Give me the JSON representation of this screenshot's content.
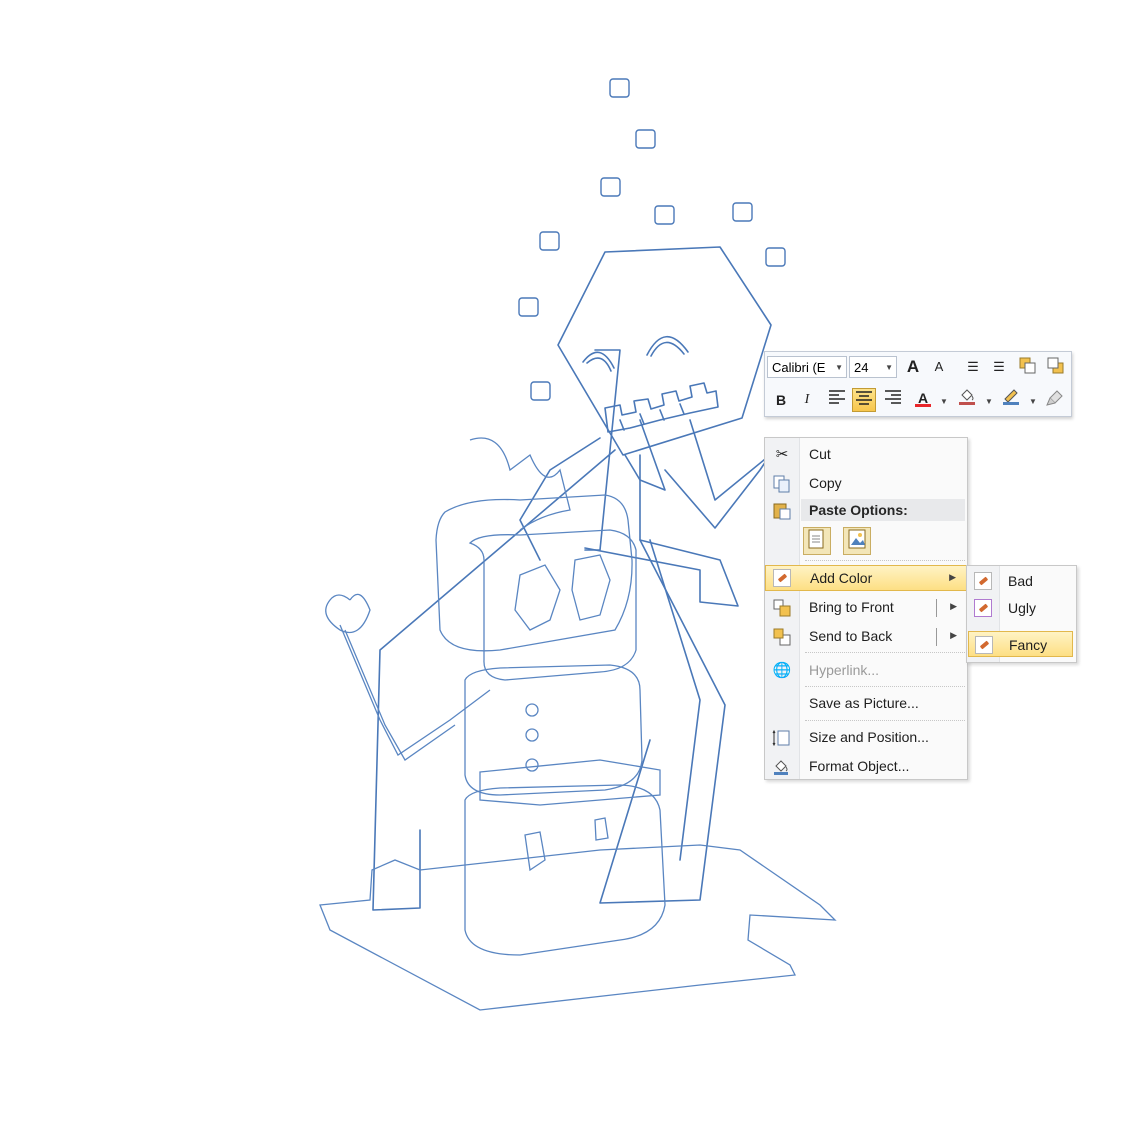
{
  "minibar": {
    "font_name": "Calibri (E",
    "font_size": "24",
    "buttons_row1": [
      "grow-font",
      "shrink-font",
      "decrease-indent",
      "increase-indent",
      "bring-forward",
      "send-backward"
    ],
    "buttons_row2": [
      "bold",
      "italic",
      "align-left",
      "align-center",
      "align-right",
      "font-color",
      "fill-color",
      "outline-color",
      "format-painter"
    ],
    "bold_glyph": "B",
    "italic_glyph": "I",
    "font_color_glyph": "A",
    "grow_glyph": "A",
    "shrink_glyph": "A",
    "active_button": "align-center",
    "colors": {
      "font": "#e8262a",
      "fill": "#c0504d",
      "outline": "#4f81bd"
    }
  },
  "context_menu": {
    "cut": "Cut",
    "copy": "Copy",
    "paste_options": "Paste Options:",
    "add_color": "Add Color",
    "bring_to_front": "Bring to Front",
    "send_to_back": "Send to Back",
    "hyperlink": "Hyperlink...",
    "save_as_picture": "Save as Picture...",
    "size_and_position": "Size and Position...",
    "format_object": "Format Object..."
  },
  "submenu": {
    "items": [
      "Bad",
      "Ugly",
      "Fancy"
    ],
    "highlighted": "Fancy"
  },
  "colors": {
    "sketch_stroke": "#4a78b8",
    "highlight": "#fddf84",
    "highlight_border": "#e2b84c"
  }
}
